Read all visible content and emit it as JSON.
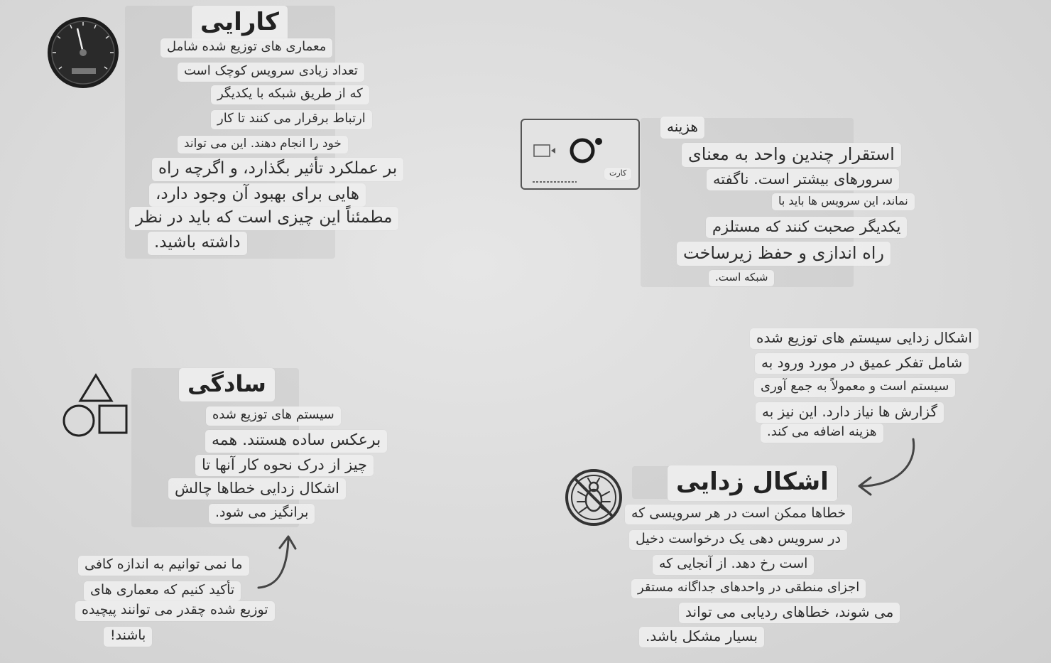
{
  "sections": {
    "performance": {
      "title": "کارایی",
      "lines": [
        "معماری های توزیع شده شامل",
        "تعداد زیادی سرویس کوچک است",
        "که از طریق شبکه با یکدیگر",
        "ارتباط برقرار می کنند تا کار",
        "خود را انجام دهند. این می تواند",
        "بر عملکرد تأثیر بگذارد، و اگرچه راه",
        "هایی برای بهبود آن وجود دارد،",
        "مطمئناً این چیزی است که باید در نظر",
        "داشته باشید."
      ]
    },
    "cost": {
      "title": "هزینه",
      "card_label": "کارت",
      "lines": [
        "استقرار چندین واحد به معنای",
        "سرورهای بیشتر است. ناگفته",
        "نماند، این سرویس ها باید با",
        "یکدیگر صحبت کنند که مستلزم",
        "راه اندازی و حفظ زیرساخت",
        "شبکه است."
      ]
    },
    "simplicity": {
      "title": "سادگی",
      "lines": [
        "سیستم های توزیع شده",
        "برعکس ساده هستند. همه",
        "چیز از درک نحوه کار آنها تا",
        "اشکال زدایی خطاها چالش",
        "برانگیز می شود."
      ],
      "note": [
        "ما نمی توانیم به اندازه کافی",
        "تأکید کنیم که معماری های",
        "توزیع شده چقدر می توانند پیچیده",
        "باشند!"
      ]
    },
    "debugging": {
      "title": "اشکال زدایی",
      "lines": [
        "خطاها ممکن است در هر سرویسی که",
        "در سرویس دهی یک درخواست دخیل",
        "است رخ دهد. از آنجایی که",
        "اجزای منطقی در واحدهای جداگانه مستقر",
        "می شوند، خطاهای ردیابی می تواند",
        "بسیار مشکل باشد."
      ],
      "note": [
        "اشکال زدایی سیستم های توزیع شده",
        "شامل تفکر عمیق در مورد ورود به",
        "سیستم است و معمولاً به جمع آوری",
        "گزارش ها نیاز دارد. این نیز به",
        "هزینه اضافه می کند."
      ]
    }
  },
  "icons": {
    "performance": "speedometer-icon",
    "cost": "credit-card-icon",
    "simplicity": "shapes-icon",
    "debugging": "no-bug-icon"
  }
}
